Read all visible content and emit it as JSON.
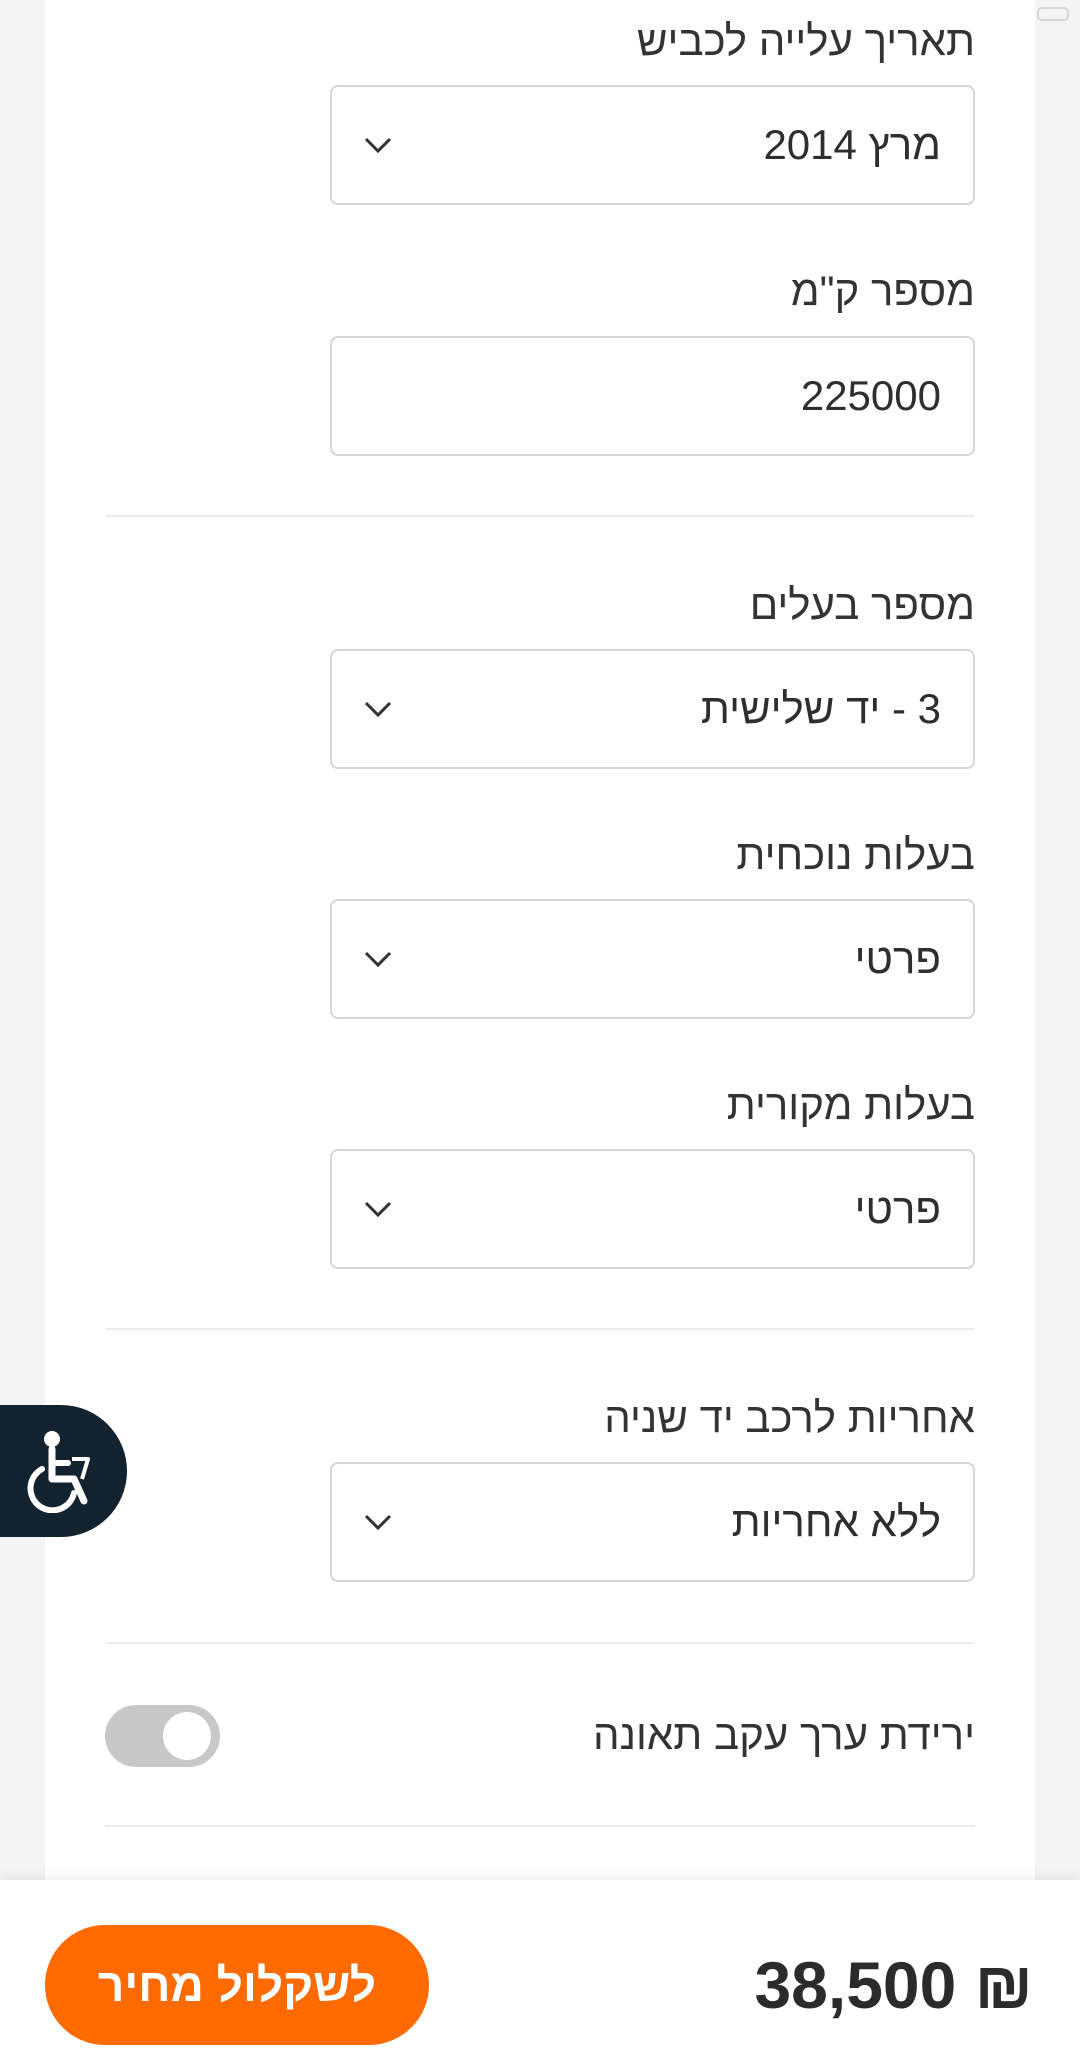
{
  "form": {
    "road_date": {
      "label": "תאריך עלייה לכביש",
      "value": "מרץ 2014"
    },
    "km": {
      "label": "מספר ק\"מ",
      "value": "225000"
    },
    "owners": {
      "label": "מספר בעלים",
      "value": "3 - יד שלישית"
    },
    "current_ownership": {
      "label": "בעלות נוכחית",
      "value": "פרטי"
    },
    "original_ownership": {
      "label": "בעלות מקורית",
      "value": "פרטי"
    },
    "warranty": {
      "label": "אחריות לרכב יד שניה",
      "value": "ללא אחריות"
    },
    "accident_drop": {
      "label": "ירידת ערך עקב תאונה",
      "enabled": false
    }
  },
  "bottom": {
    "price": "₪ 38,500",
    "cta_label": "לשקלול מחיר"
  },
  "colors": {
    "accent": "#ff6b00",
    "a11y_bg": "#13222f"
  },
  "icons": {
    "dropdown": "chevron-down-icon",
    "accessibility": "wheelchair-icon"
  }
}
